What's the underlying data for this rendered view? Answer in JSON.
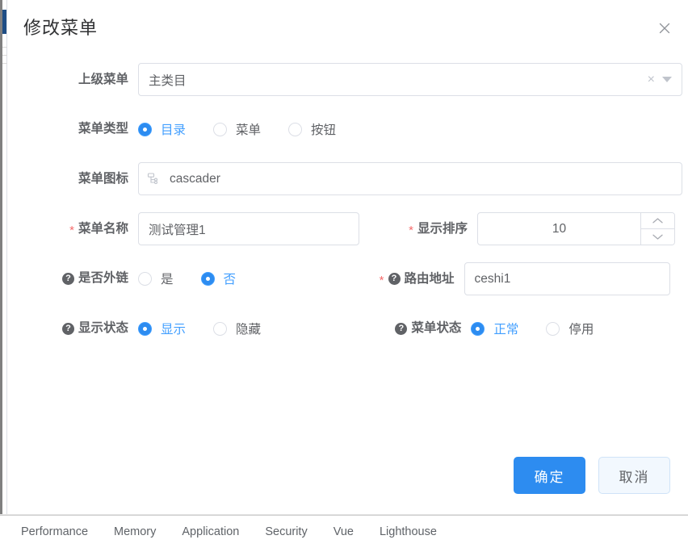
{
  "dialog": {
    "title": "修改菜单",
    "close_label": "×",
    "close_icon": "close-icon"
  },
  "form": {
    "parent_menu": {
      "label": "上级菜单",
      "value": "主类目",
      "clear_icon": "×",
      "caret_icon": "chevron-down-icon"
    },
    "menu_type": {
      "label": "菜单类型",
      "options": [
        {
          "label": "目录",
          "selected": true
        },
        {
          "label": "菜单",
          "selected": false
        },
        {
          "label": "按钮",
          "selected": false
        }
      ]
    },
    "menu_icon": {
      "label": "菜单图标",
      "value": "cascader",
      "prefix_icon": "cascader-icon"
    },
    "menu_name": {
      "label": "菜单名称",
      "required_mark": "*",
      "value": "测试管理1"
    },
    "display_order": {
      "label": "显示排序",
      "required_mark": "*",
      "value": "10",
      "increase_icon": "chevron-up-icon",
      "decrease_icon": "chevron-down-icon"
    },
    "is_external": {
      "label": "是否外链",
      "help_mark": "?",
      "options": [
        {
          "label": "是",
          "selected": false
        },
        {
          "label": "否",
          "selected": true
        }
      ]
    },
    "route_path": {
      "label": "路由地址",
      "required_mark": "*",
      "help_mark": "?",
      "value": "ceshi1"
    },
    "display_status": {
      "label": "显示状态",
      "help_mark": "?",
      "options": [
        {
          "label": "显示",
          "selected": true
        },
        {
          "label": "隐藏",
          "selected": false
        }
      ]
    },
    "menu_status": {
      "label": "菜单状态",
      "help_mark": "?",
      "options": [
        {
          "label": "正常",
          "selected": true
        },
        {
          "label": "停用",
          "selected": false
        }
      ]
    }
  },
  "footer": {
    "confirm_label": "确定",
    "cancel_label": "取消"
  },
  "devtools": {
    "tabs": [
      {
        "label": "Performance"
      },
      {
        "label": "Memory"
      },
      {
        "label": "Application"
      },
      {
        "label": "Security"
      },
      {
        "label": "Vue"
      },
      {
        "label": "Lighthouse"
      }
    ]
  },
  "colors": {
    "accent": "#2d8cf0",
    "accent_text": "#409eff",
    "label": "#606266",
    "required": "#f56c6c",
    "border": "#dcdfe6",
    "sidebar_accent": "#1f4e85"
  }
}
